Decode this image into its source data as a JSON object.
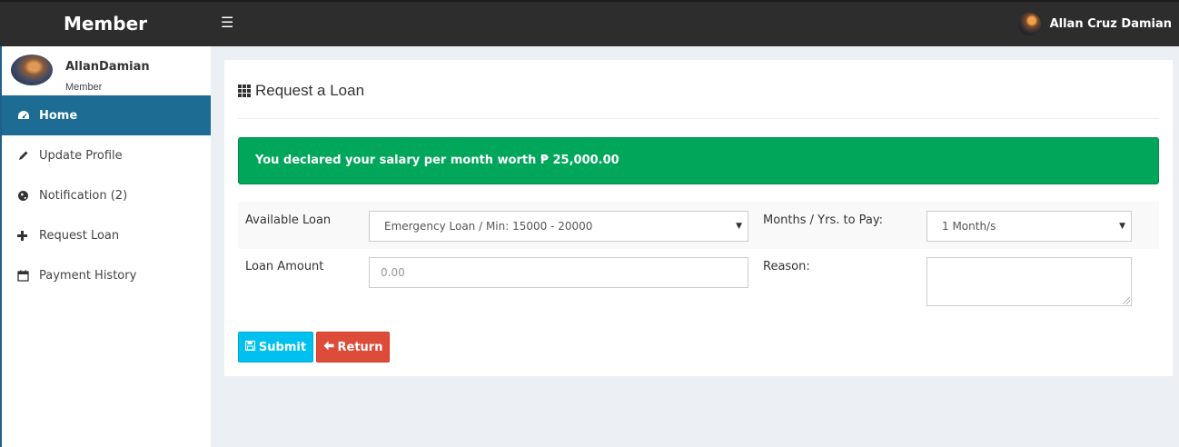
{
  "header": {
    "brand": "Member",
    "user_name": "Allan Cruz Damian"
  },
  "sidebar": {
    "user_name": "AllanDamian",
    "user_role": "Member",
    "items": [
      {
        "label": "Home",
        "icon": "dashboard-icon"
      },
      {
        "label": "Update Profile",
        "icon": "pencil-icon"
      },
      {
        "label": "Notification (2)",
        "icon": "globe-icon"
      },
      {
        "label": "Request Loan",
        "icon": "plus-icon"
      },
      {
        "label": "Payment History",
        "icon": "calendar-icon"
      }
    ]
  },
  "main": {
    "title": "Request a Loan",
    "alert_text": "You declared your salary per month worth ₱ 25,000.00",
    "form": {
      "available_loan_label": "Available Loan",
      "available_loan_value": "Emergency Loan / Min: 15000 - 20000",
      "months_label": "Months / Yrs. to Pay:",
      "months_value": "1 Month/s",
      "loan_amount_label": "Loan Amount",
      "loan_amount_placeholder": "0.00",
      "reason_label": "Reason:"
    },
    "buttons": {
      "submit": "Submit",
      "return": "Return"
    }
  },
  "colors": {
    "topbar": "#2d2d2d",
    "sidebar_active": "#1c6c94",
    "alert_success": "#00a65a",
    "button_submit": "#00c0ef",
    "button_return": "#dd4b39"
  }
}
